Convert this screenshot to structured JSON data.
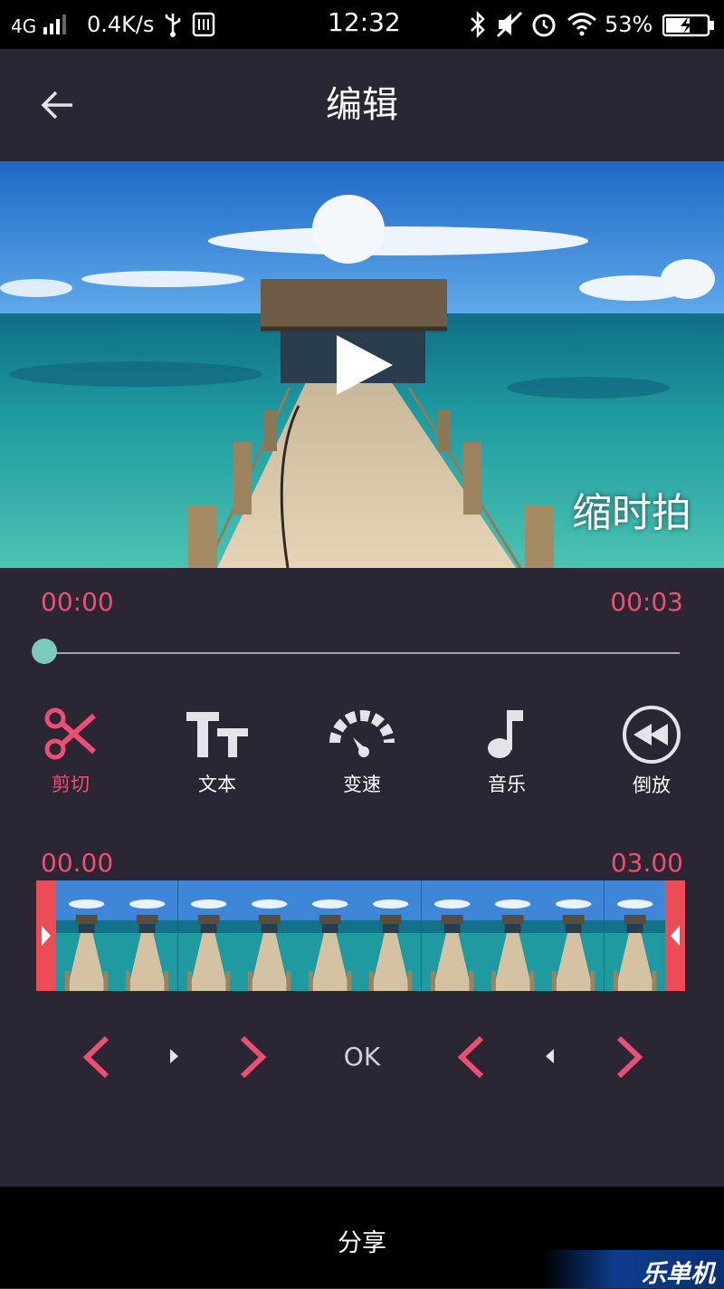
{
  "status_bar": {
    "network": "4G",
    "speed": "0.4K/s",
    "time": "12:32",
    "battery": "53%",
    "icons": [
      "signal-icon",
      "usb-icon",
      "storage-icon",
      "bluetooth-icon",
      "mute-icon",
      "alarm-icon",
      "wifi-icon",
      "battery-charging-icon"
    ]
  },
  "header": {
    "title": "编辑",
    "back_icon": "back-arrow-icon"
  },
  "video": {
    "watermark": "缩时拍",
    "play_icon": "play-icon"
  },
  "playback": {
    "current": "00:00",
    "total": "00:03",
    "progress": 0
  },
  "tools": [
    {
      "label": "剪切",
      "icon": "scissors-icon",
      "active": true
    },
    {
      "label": "文本",
      "icon": "text-icon",
      "active": false
    },
    {
      "label": "变速",
      "icon": "speed-gauge-icon",
      "active": false
    },
    {
      "label": "音乐",
      "icon": "music-note-icon",
      "active": false
    },
    {
      "label": "倒放",
      "icon": "rewind-icon",
      "active": false
    }
  ],
  "trim": {
    "start": "00.00",
    "end": "03.00",
    "frame_count": 10
  },
  "trim_controls": {
    "ok_label": "OK"
  },
  "footer": {
    "share_label": "分享",
    "brand": "乐单机"
  },
  "colors": {
    "accent": "#ef4e74",
    "background": "#2b2633",
    "seek_thumb": "#7ec9bf",
    "handle": "#ec4c55"
  }
}
